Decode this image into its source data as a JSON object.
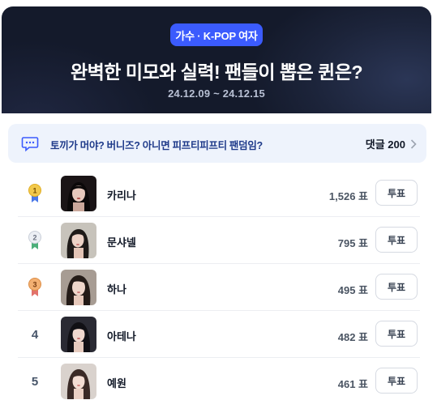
{
  "header": {
    "badge": "가수 · K-POP 여자",
    "title": "완벽한 미모와 실력! 팬들이 뽑은 퀸은?",
    "date_range": "24.12.09 ~ 24.12.15"
  },
  "banner": {
    "text": "토끼가 머야? 버니즈? 아니면 피프티피프티 팬덤임?",
    "comments_label": "댓글 200",
    "icon": "chat-bubble-icon"
  },
  "ranking": [
    {
      "rank": "1",
      "medal": "gold",
      "name": "카리나",
      "votes": "1,526 표",
      "button": "투표"
    },
    {
      "rank": "2",
      "medal": "silver",
      "name": "문샤넬",
      "votes": "795 표",
      "button": "투표"
    },
    {
      "rank": "3",
      "medal": "bronze",
      "name": "하나",
      "votes": "495 표",
      "button": "투표"
    },
    {
      "rank": "4",
      "medal": "",
      "name": "아테나",
      "votes": "482 표",
      "button": "투표"
    },
    {
      "rank": "5",
      "medal": "",
      "name": "예원",
      "votes": "461 표",
      "button": "투표"
    }
  ],
  "colors": {
    "accent": "#3b5bfd",
    "hero_bg": "#141a2b",
    "banner_bg": "#eef3fc",
    "medal_gold": "#f2c94c",
    "medal_silver": "#d9dde6",
    "medal_bronze": "#f0a868"
  }
}
